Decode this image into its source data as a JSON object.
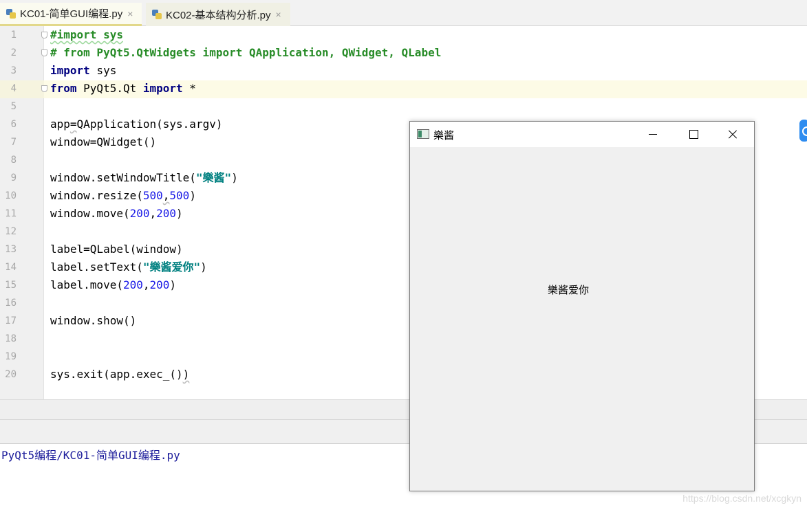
{
  "tabs": [
    {
      "label": "KC01-简单GUI编程.py",
      "close": "×",
      "active": true
    },
    {
      "label": "KC02-基本结构分析.py",
      "close": "×",
      "active": false
    }
  ],
  "editor": {
    "current_line": 4,
    "lines": [
      {
        "n": "1",
        "tokens": [
          {
            "t": "#import sys",
            "c": "cm squig"
          }
        ]
      },
      {
        "n": "2",
        "tokens": [
          {
            "t": "# from PyQt5.QtWidgets import QApplication, QWidget, QLabel",
            "c": "cm"
          }
        ]
      },
      {
        "n": "3",
        "tokens": [
          {
            "t": "import",
            "c": "kw"
          },
          {
            "t": " sys",
            "c": ""
          }
        ]
      },
      {
        "n": "4",
        "tokens": [
          {
            "t": "from",
            "c": "kw"
          },
          {
            "t": " PyQt5.Qt ",
            "c": ""
          },
          {
            "t": "import",
            "c": "kw"
          },
          {
            "t": " *",
            "c": ""
          }
        ]
      },
      {
        "n": "5",
        "tokens": []
      },
      {
        "n": "6",
        "tokens": [
          {
            "t": "app",
            "c": ""
          },
          {
            "t": "=",
            "c": "squig-g"
          },
          {
            "t": "QApplication(sys.argv)",
            "c": ""
          }
        ]
      },
      {
        "n": "7",
        "tokens": [
          {
            "t": "window=QWidget()",
            "c": ""
          }
        ]
      },
      {
        "n": "8",
        "tokens": []
      },
      {
        "n": "9",
        "tokens": [
          {
            "t": "window.setWindowTitle(",
            "c": ""
          },
          {
            "t": "\"樂酱\"",
            "c": "str"
          },
          {
            "t": ")",
            "c": ""
          }
        ]
      },
      {
        "n": "10",
        "tokens": [
          {
            "t": "window.resize(",
            "c": ""
          },
          {
            "t": "500",
            "c": "num"
          },
          {
            "t": ",",
            "c": "squig-g"
          },
          {
            "t": "500",
            "c": "num"
          },
          {
            "t": ")",
            "c": ""
          }
        ]
      },
      {
        "n": "11",
        "tokens": [
          {
            "t": "window.move(",
            "c": ""
          },
          {
            "t": "200",
            "c": "num"
          },
          {
            "t": ",",
            "c": ""
          },
          {
            "t": "200",
            "c": "num"
          },
          {
            "t": ")",
            "c": ""
          }
        ]
      },
      {
        "n": "12",
        "tokens": []
      },
      {
        "n": "13",
        "tokens": [
          {
            "t": "label=QLabel(window)",
            "c": ""
          }
        ]
      },
      {
        "n": "14",
        "tokens": [
          {
            "t": "label.setText(",
            "c": ""
          },
          {
            "t": "\"樂酱爱你\"",
            "c": "str"
          },
          {
            "t": ")",
            "c": ""
          }
        ]
      },
      {
        "n": "15",
        "tokens": [
          {
            "t": "label.move(",
            "c": ""
          },
          {
            "t": "200",
            "c": "num"
          },
          {
            "t": ",",
            "c": ""
          },
          {
            "t": "200",
            "c": "num"
          },
          {
            "t": ")",
            "c": ""
          }
        ]
      },
      {
        "n": "16",
        "tokens": []
      },
      {
        "n": "17",
        "tokens": [
          {
            "t": "window.show()",
            "c": ""
          }
        ]
      },
      {
        "n": "18",
        "tokens": []
      },
      {
        "n": "19",
        "tokens": []
      },
      {
        "n": "20",
        "tokens": [
          {
            "t": "sys.exit(app.exec_()",
            "c": ""
          },
          {
            "t": ")",
            "c": "squig-g"
          }
        ]
      }
    ]
  },
  "console": {
    "path": "PyQt5编程/KC01-简单GUI编程.py",
    "watermark": "https://blog.csdn.net/xcgkyn"
  },
  "qt_window": {
    "title": "樂酱",
    "label_text": "樂酱爱你"
  }
}
